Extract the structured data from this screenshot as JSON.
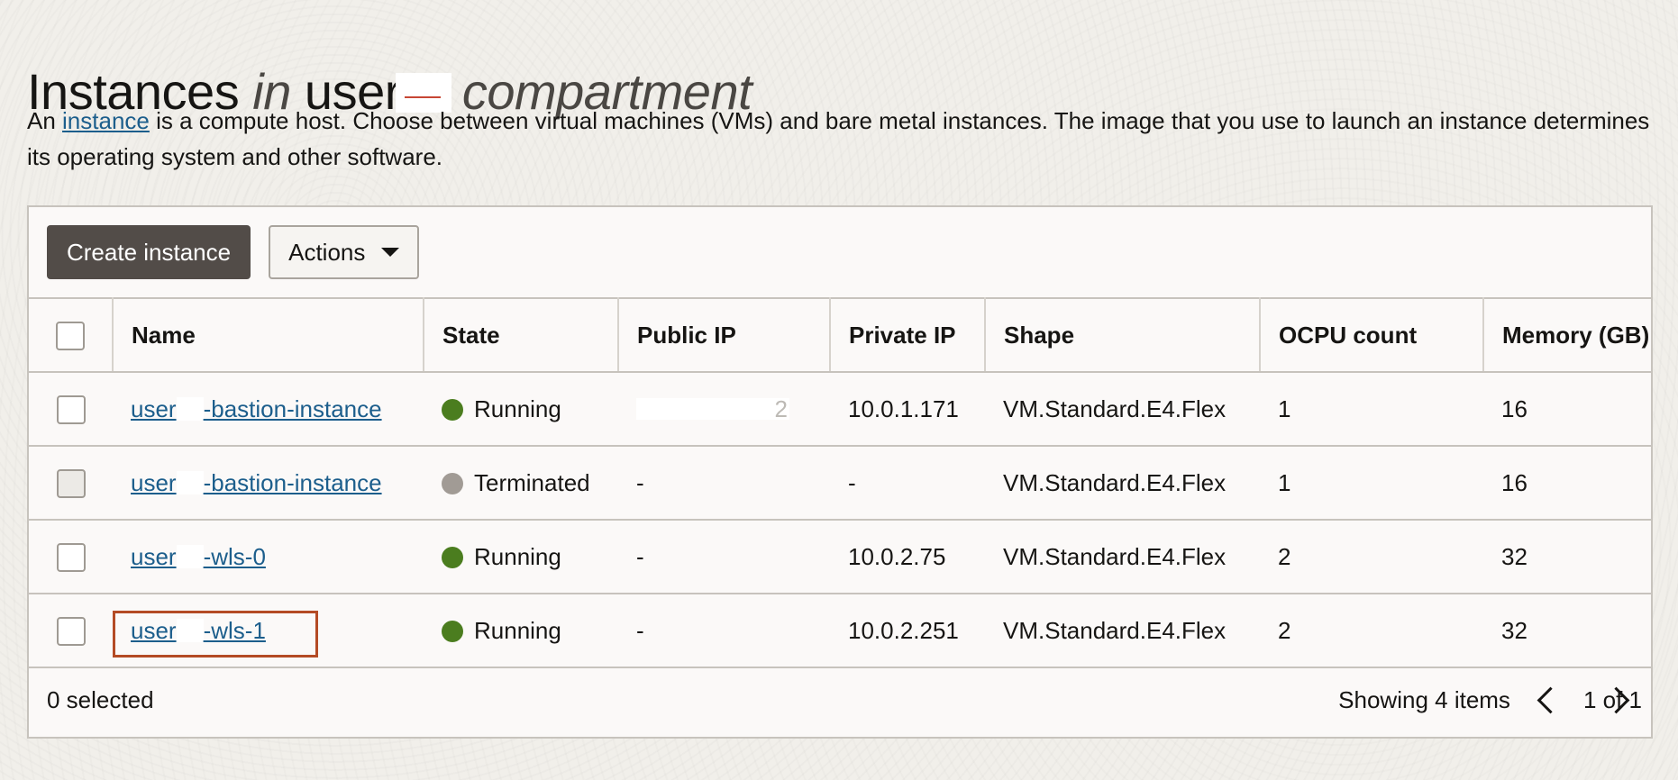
{
  "header": {
    "title_word1": "Instances",
    "title_in": "in",
    "title_user": "user",
    "title_compartment": "compartment"
  },
  "description": {
    "prefix": "An ",
    "link": "instance",
    "text": " is a compute host. Choose between virtual machines (VMs) and bare metal instances. The image that you use to launch an instance determines its operating system and other software."
  },
  "toolbar": {
    "create_label": "Create instance",
    "actions_label": "Actions"
  },
  "table": {
    "columns": [
      "Name",
      "State",
      "Public IP",
      "Private IP",
      "Shape",
      "OCPU count",
      "Memory (GB)"
    ],
    "rows": [
      {
        "name_prefix": "user",
        "name_suffix": "-bastion-instance",
        "state": "Running",
        "state_color": "#4b7d1f",
        "public_ip": "",
        "private_ip": "10.0.1.171",
        "shape": "VM.Standard.E4.Flex",
        "ocpu": "1",
        "memory": "16"
      },
      {
        "name_prefix": "user",
        "name_suffix": "-bastion-instance",
        "state": "Terminated",
        "state_color": "#a19b95",
        "public_ip": "-",
        "private_ip": "-",
        "shape": "VM.Standard.E4.Flex",
        "ocpu": "1",
        "memory": "16"
      },
      {
        "name_prefix": "user",
        "name_suffix": "-wls-0",
        "state": "Running",
        "state_color": "#4b7d1f",
        "public_ip": "-",
        "private_ip": "10.0.2.75",
        "shape": "VM.Standard.E4.Flex",
        "ocpu": "2",
        "memory": "32"
      },
      {
        "name_prefix": "user",
        "name_suffix": "-wls-1",
        "state": "Running",
        "state_color": "#4b7d1f",
        "public_ip": "-",
        "private_ip": "10.0.2.251",
        "shape": "VM.Standard.E4.Flex",
        "ocpu": "2",
        "memory": "32"
      }
    ]
  },
  "footer": {
    "selected_text": "0 selected",
    "showing_text": "Showing 4 items",
    "page_text": "1 of 1"
  }
}
